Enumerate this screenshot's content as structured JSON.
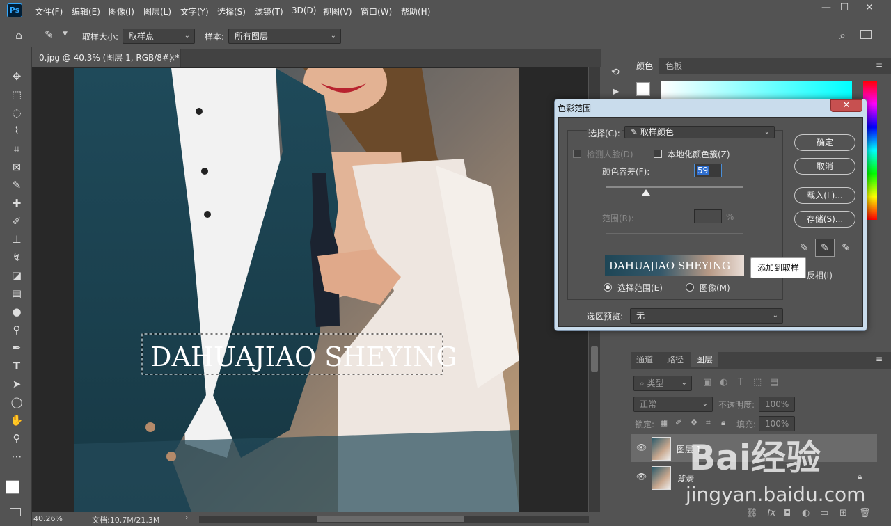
{
  "app": {
    "logo": "Ps"
  },
  "menu": [
    "文件(F)",
    "编辑(E)",
    "图像(I)",
    "图层(L)",
    "文字(Y)",
    "选择(S)",
    "滤镜(T)",
    "3D(D)",
    "视图(V)",
    "窗口(W)",
    "帮助(H)"
  ],
  "window_controls": {
    "minimize": "—",
    "maximize": "☐",
    "close": "✕"
  },
  "options": {
    "sample_size_label": "取样大小:",
    "sample_size_value": "取样点",
    "sample_label": "样本:",
    "sample_value": "所有图层"
  },
  "document": {
    "tab_title": "0.jpg @ 40.3% (图层 1, RGB/8#) *",
    "tab_close": "×",
    "canvas_text": "DAHUAJIAO SHEYING"
  },
  "status": {
    "zoom": "40.26%",
    "doc_info": "文档:10.7M/21.3M"
  },
  "color_panel": {
    "tabs": [
      "颜色",
      "色板"
    ]
  },
  "layers_panel": {
    "tabs": [
      "通道",
      "路径",
      "图层"
    ],
    "filter_kind": "类型",
    "blend_mode": "正常",
    "opacity_label": "不透明度:",
    "opacity_value": "100%",
    "lock_label": "锁定:",
    "fill_label": "填充:",
    "fill_value": "100%",
    "layers": [
      {
        "name": "图层 1"
      },
      {
        "name": "背景"
      }
    ]
  },
  "dialog": {
    "title": "色彩范围",
    "close": "✕",
    "select_label": "选择(C):",
    "select_value": "取样颜色",
    "detect_faces": "检测人脸(D)",
    "localized_clusters": "本地化颜色簇(Z)",
    "fuzziness_label": "颜色容差(F):",
    "fuzziness_value": "59",
    "fuzziness_fraction": 0.29,
    "range_label": "范围(R):",
    "range_unit": "%",
    "preview_text": "DAHUAJIAO SHEYING",
    "radio_selection": "选择范围(E)",
    "radio_image": "图像(M)",
    "preview_label": "选区预览:",
    "preview_value": "无",
    "buttons": {
      "ok": "确定",
      "cancel": "取消",
      "load": "载入(L)...",
      "save": "存储(S)..."
    },
    "invert": "反相(I)",
    "tooltip": "添加到取样"
  },
  "watermark": {
    "brand": "Bai经验",
    "url": "jingyan.baidu.com"
  }
}
